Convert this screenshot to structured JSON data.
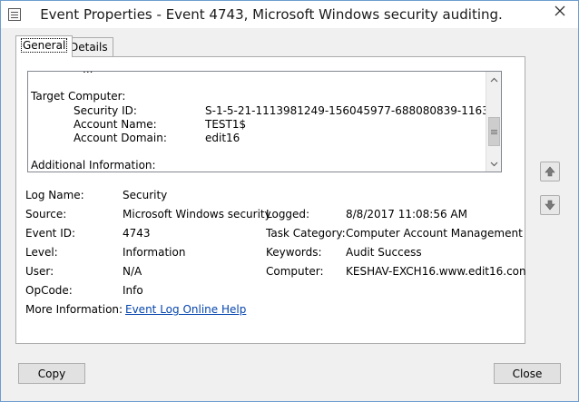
{
  "window": {
    "title": "Event Properties - Event 4743, Microsoft Windows security auditing."
  },
  "tabs": [
    {
      "label": "General",
      "active": true
    },
    {
      "label": "Details",
      "active": false
    }
  ],
  "description": {
    "cut_text": "...",
    "target_computer_heading": "Target Computer:",
    "rows": [
      {
        "label": "Security ID:",
        "value": "S-1-5-21-1113981249-156045977-688080839-1163"
      },
      {
        "label": "Account Name:",
        "value": "TEST1$"
      },
      {
        "label": "Account Domain:",
        "value": "edit16"
      }
    ],
    "additional_heading": "Additional Information:"
  },
  "fields": {
    "log_name_label": "Log Name:",
    "log_name": "Security",
    "source_label": "Source:",
    "source": "Microsoft Windows security",
    "logged_label": "Logged:",
    "logged": "8/8/2017 11:08:56 AM",
    "event_id_label": "Event ID:",
    "event_id": "4743",
    "task_category_label": "Task Category:",
    "task_category": "Computer Account Management",
    "level_label": "Level:",
    "level": "Information",
    "keywords_label": "Keywords:",
    "keywords": "Audit Success",
    "user_label": "User:",
    "user": "N/A",
    "computer_label": "Computer:",
    "computer": "KESHAV-EXCH16.www.edit16.con",
    "opcode_label": "OpCode:",
    "opcode": "Info",
    "more_info_label": "More Information:",
    "more_info_link": "Event Log Online Help"
  },
  "buttons": {
    "copy": "Copy",
    "close": "Close"
  },
  "colors": {
    "link": "#0645ad",
    "arrow_green": "#4f9a6b"
  }
}
